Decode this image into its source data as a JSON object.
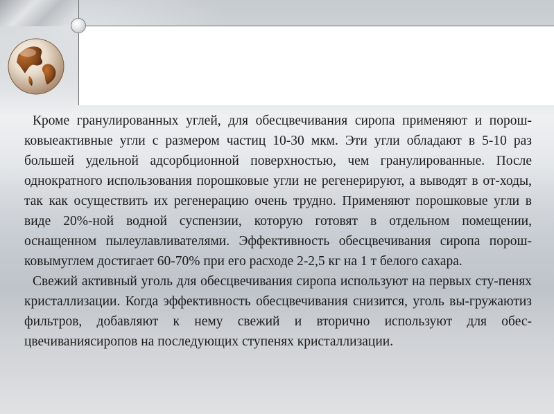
{
  "paragraphs": [
    "Кроме гранулированных углей, для обесцвечивания сиропа применяют и порош-ковыеактивные угли с размером частиц 10-30 мкм. Эти угли обладают в 5-10 раз большей удельной адсорбционной поверхностью, чем гранулированные. После однократного использования порошковые угли не регенерируют, а выводят в от-ходы, так как осуществить их регенерацию очень трудно. Применяют порошковые угли в виде 20%-ной водной суспензии, которую готовят в отдельном помещении, оснащенном пылеулавливателями. Эффективность обесцвечивания сиропа порош-ковымуглем достигает 60-70% при его расходе 2-2,5 кг на 1 т белого сахара.",
    "Свежий активный уголь для обесцвечивания сиропа используют на первых сту-пенях кристаллизации. Когда эффективность обесцвечивания снизится, уголь вы-гружаютиз фильтров, добавляют к нему свежий и вторично используют для обес-цвечиваниясиропов на последующих ступенях кристаллизации."
  ],
  "icons": {
    "globe": "globe-icon",
    "bullet": "circle-dot-icon"
  },
  "colors": {
    "text": "#1c1c1c",
    "panel": "#ffffff",
    "rule": "#6e6e6e",
    "globe": "#8a4a1c"
  }
}
